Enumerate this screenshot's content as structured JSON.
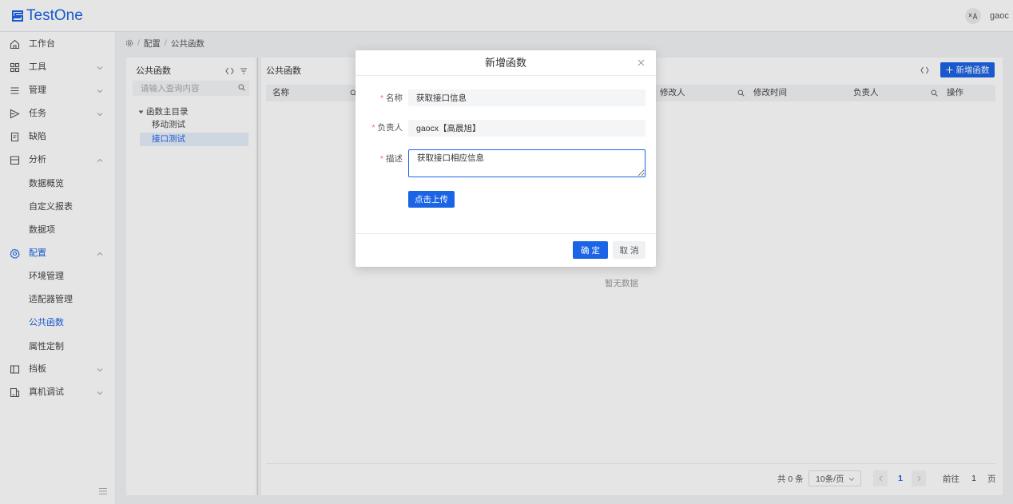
{
  "colors": {
    "primary": "#1c64e6",
    "overlay": "rgba(0,0,0,0.1)",
    "required": "#f56c6c"
  },
  "header": {
    "logo_text": "TestOne",
    "lang_icon": "translate-icon",
    "user_name": "gaoc"
  },
  "sidebar": {
    "items": [
      {
        "label": "工作台",
        "icon": "home-icon"
      },
      {
        "label": "工具",
        "icon": "grid-icon",
        "expanded": false
      },
      {
        "label": "管理",
        "icon": "list-icon",
        "expanded": false
      },
      {
        "label": "任务",
        "icon": "play-arrow-icon",
        "expanded": false
      },
      {
        "label": "缺陷",
        "icon": "document-icon"
      },
      {
        "label": "分析",
        "icon": "calendar-icon",
        "expanded": true,
        "children": [
          "数据概览",
          "自定义报表",
          "数据项"
        ]
      },
      {
        "label": "配置",
        "icon": "gear-icon",
        "expanded": true,
        "active": true,
        "children": [
          "环境管理",
          "适配器管理",
          "公共函数",
          "属性定制"
        ],
        "active_child_index": 2
      },
      {
        "label": "挡板",
        "icon": "panel-icon",
        "expanded": false
      },
      {
        "label": "真机调试",
        "icon": "device-icon",
        "expanded": false
      }
    ],
    "collapse_icon": "collapse-menu-icon"
  },
  "breadcrumb": {
    "items": [
      "配置",
      "公共函数"
    ],
    "separator": "/"
  },
  "tree_panel": {
    "title": "公共函数",
    "search_placeholder": "请输入查询内容",
    "root_label": "函数主目录",
    "children": [
      "移动测试",
      "接口测试"
    ],
    "selected_index": 1
  },
  "main": {
    "title": "公共函数",
    "add_button": "新增函数",
    "columns": [
      {
        "label": "名称",
        "filter": true
      },
      {
        "label": "修改人",
        "filter": true
      },
      {
        "label": "修改时间",
        "filter": false
      },
      {
        "label": "负责人",
        "filter": true
      },
      {
        "label": "操作",
        "filter": false
      }
    ],
    "empty_text": "暂无数据",
    "pagination": {
      "total_text": "共 0 条",
      "page_size": "10条/页",
      "current_page": 1,
      "goto_label": "前往",
      "goto_value": "1",
      "page_suffix": "页"
    }
  },
  "modal": {
    "title": "新增函数",
    "fields": [
      {
        "label": "名称",
        "required": true,
        "value": "获取接口信息"
      },
      {
        "label": "负责人",
        "required": true,
        "value": "gaocx【高晨旭】"
      },
      {
        "label": "描述",
        "required": true,
        "value": "获取接口相应信息"
      }
    ],
    "upload_button": "点击上传",
    "confirm_button": "确 定",
    "cancel_button": "取 消"
  }
}
